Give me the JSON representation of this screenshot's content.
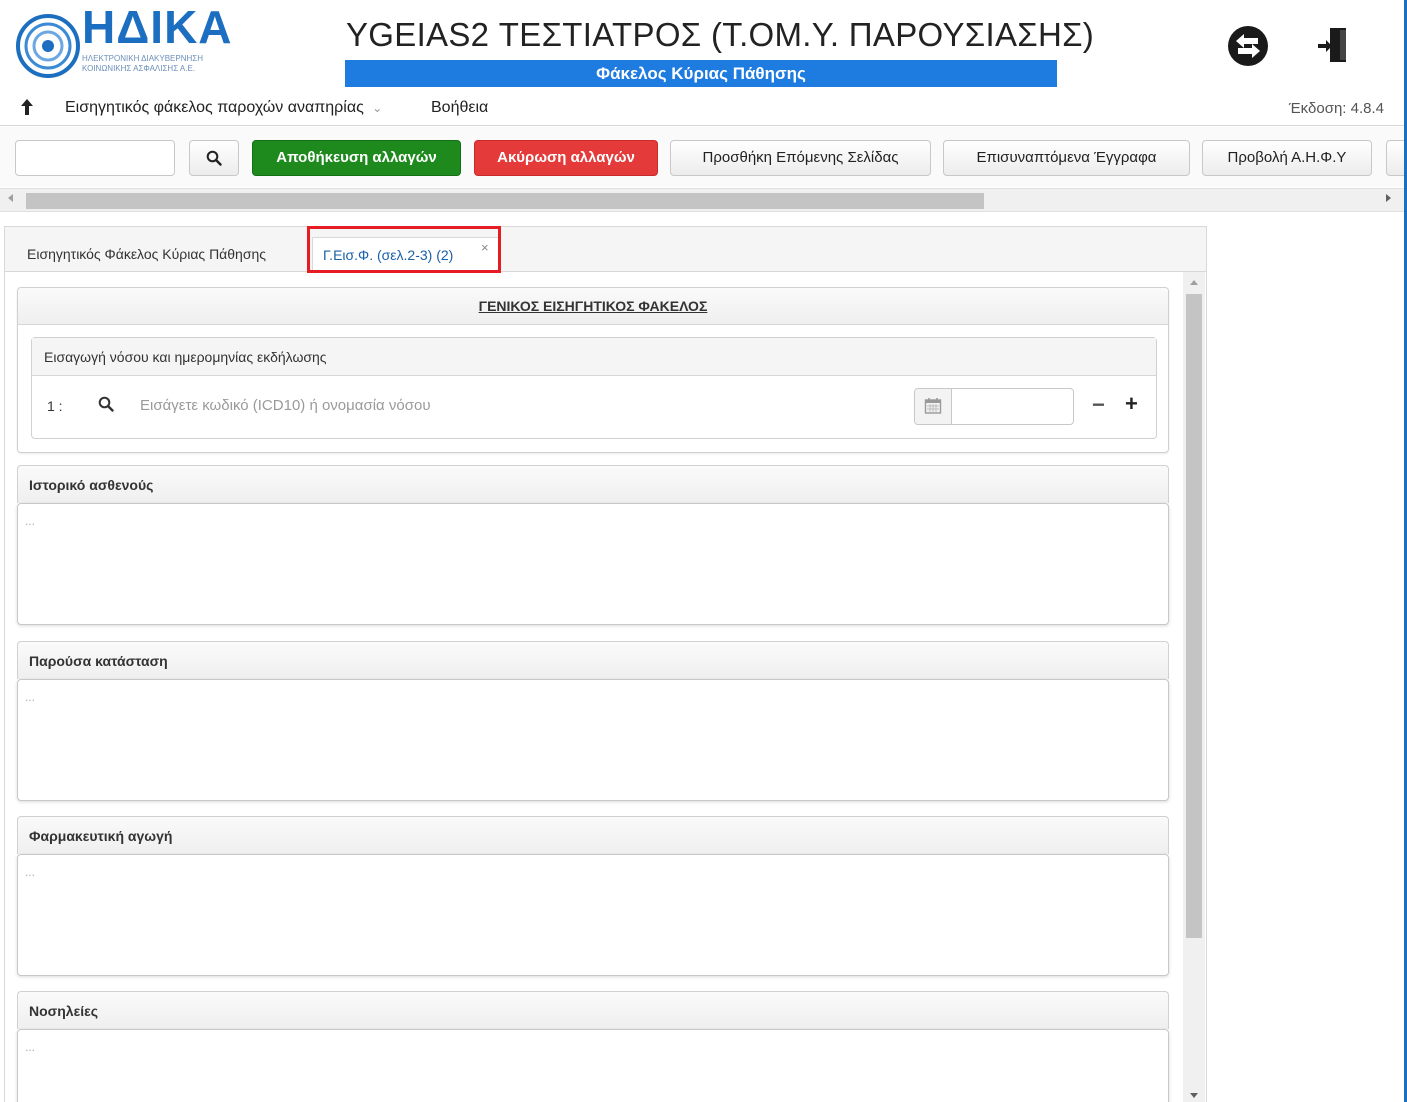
{
  "header": {
    "logo_title": "ΗΔΙΚΑ",
    "logo_subtitle_line1": "ΗΛΕΚΤΡΟΝΙΚΗ ΔΙΑΚΥΒΕΡΝΗΣΗ",
    "logo_subtitle_line2": "ΚΟΙΝΩΝΙΚΗΣ ΑΣΦΑΛΙΣΗΣ Α.Ε.",
    "app_title": "YGEIAS2 ΤΕΣΤΙΑΤΡΟΣ (Τ.ΟΜ.Υ. ΠΑΡΟΥΣΙΑΣΗΣ)",
    "subtitle": "Φάκελος Κύριας Πάθησης",
    "brand_color": "#1e7be0"
  },
  "menu": {
    "up_icon": "arrow-up-icon",
    "file_menu": "Εισηγητικός φάκελος παροχών αναπηρίας",
    "help": "Βοήθεια",
    "version": "Έκδοση: 4.8.4"
  },
  "toolbar": {
    "search_value": "",
    "save": "Αποθήκευση αλλαγών",
    "cancel": "Ακύρωση αλλαγών",
    "add_page": "Προσθήκη Επόμενης Σελίδας",
    "attachments": "Επισυναπτόμενα Έγγραφα",
    "view_ahfy": "Προβολή Α.Η.Φ.Υ"
  },
  "tabs": [
    {
      "label": "Εισηγητικός Φάκελος Κύριας Πάθησης",
      "active": false
    },
    {
      "label": "Γ.Εισ.Φ. (σελ.2-3) (2)",
      "active": true,
      "close": "×"
    }
  ],
  "general": {
    "title": "ΓΕΝΙΚΟΣ ΕΙΣΗΓΗΤΙΚΟΣ ΦΑΚΕΛΟΣ",
    "disease_section": "Εισαγωγή νόσου και ημερομηνίας εκδήλωσης",
    "row_number": "1 :",
    "disease_placeholder": "Εισάγετε κωδικό (ICD10) ή ονομασία νόσου",
    "date_value": "",
    "minus": "−",
    "plus": "+"
  },
  "sections": [
    {
      "title": "Ιστορικό ασθενούς",
      "value": "..."
    },
    {
      "title": "Παρούσα κατάσταση",
      "value": "..."
    },
    {
      "title": "Φαρμακευτική αγωγή",
      "value": "..."
    },
    {
      "title": "Νοσηλείες",
      "value": "..."
    }
  ]
}
